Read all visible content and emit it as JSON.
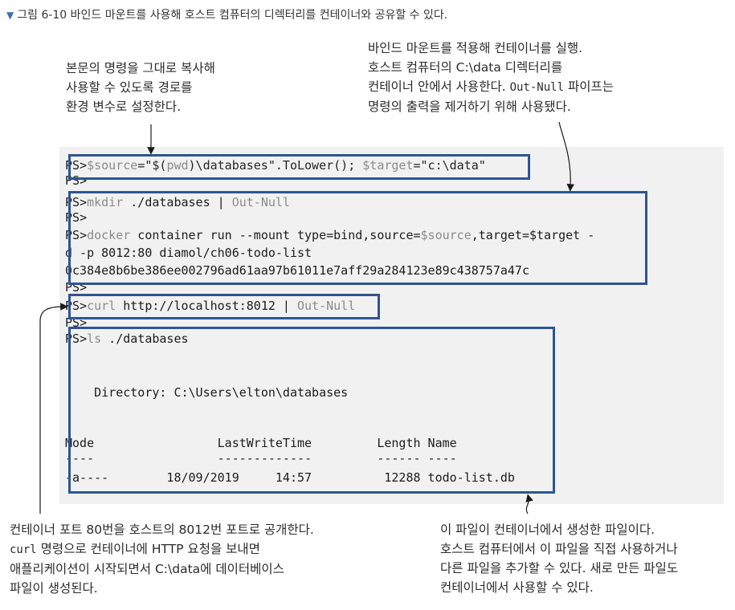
{
  "caption": {
    "icon": "down-triangle-icon",
    "text": "그림 6-10 바인드 마운트를 사용해 호스트 컴퓨터의 디렉터리를 컨테이너와 공유할 수 있다."
  },
  "notes": {
    "top_left": [
      "본문의 명령을 그대로 복사해",
      "사용할 수 있도록 경로를",
      "환경 변수로 설정한다."
    ],
    "top_right": {
      "line1": "바인드 마운트를 적용해 컨테이너를 실행.",
      "line2": "호스트 컴퓨터의 C:\\data 디렉터리를",
      "line3_before": "컨테이너 안에서 사용한다. ",
      "line3_mono": "Out-Null",
      "line3_after": " 파이프는",
      "line4": "명령의 출력을 제거하기 위해 사용됐다."
    },
    "bottom_left": {
      "line1": "컨테이너 포트 80번을 호스트의 8012번 포트로 공개한다.",
      "line2_mono": "curl",
      "line2_after": " 명령으로 컨테이너에 HTTP 요청을 보내면",
      "line3": "애플리케이션이 시작되면서 C:\\data에 데이터베이스",
      "line4": "파일이 생성된다."
    },
    "bottom_right": [
      "이 파일이 컨테이너에서 생성한 파일이다.",
      "호스트 컴퓨터에서 이 파일을 직접 사용하거나",
      "다른 파일을 추가할 수 있다. 새로 만든 파일도",
      "컨테이너에서 사용할 수 있다."
    ]
  },
  "terminal": {
    "prompt": "PS",
    "gt": ">",
    "line1": {
      "a": "$source",
      "b": "=\"$(",
      "c": "pwd",
      "d": ")\\databases\".ToLower(); ",
      "e": "$target",
      "f": "=\"c:\\data\""
    },
    "line3": {
      "cmd": "mkdir",
      "arg": " ./databases | ",
      "cmdlet": "Out-Null"
    },
    "line5": {
      "cmd": "docker",
      "a": " container run --mount type=bind,source=",
      "v1": "$source",
      "b": ",target=$target -"
    },
    "line6": "d -p 8012:80 diamol/ch06-todo-list",
    "line7": "0c384e8b6be386ee002796ad61aa97b61011e7aff29a284123e89c438757a47c",
    "line9": {
      "cmd": "curl",
      "arg": " http://localhost:8012 | ",
      "cmdlet": "Out-Null"
    },
    "line11": {
      "cmd": "ls",
      "arg": " ./databases"
    },
    "directory": "    Directory: C:\\Users\\elton\\databases",
    "header": "Mode                 LastWriteTime         Length Name",
    "dashes": "----                 -------------         ------ ----",
    "row": "-a----        18/09/2019     14:57          12288 todo-list.db"
  }
}
